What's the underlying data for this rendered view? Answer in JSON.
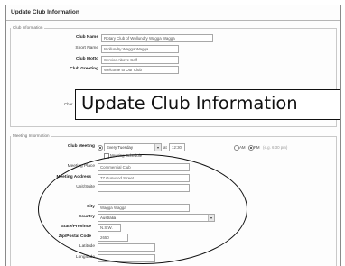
{
  "window": {
    "title": "Update Club Information"
  },
  "club_info": {
    "section_label": "Club information",
    "fields": [
      {
        "label": "Club Name",
        "value": "Rotary Club of Wollundry Wagga Wagga"
      },
      {
        "label": "Short Name",
        "value": "Wollundry Wagga Wagga"
      },
      {
        "label": "Club Motto",
        "value": "Service Above Self"
      },
      {
        "label": "Club Greeting",
        "value": "Welcome to Our Club"
      }
    ],
    "charter_label": "Char"
  },
  "meeting_info": {
    "section_label": "Meeting Information",
    "club_meeting": {
      "label": "Club Meeting",
      "frequency": "Every Tuesday",
      "at_label": "at",
      "time": "12:30",
      "am_label": "AM",
      "pm_label": "PM",
      "ampm_selected": "PM",
      "extra": "(e.g. 6:30 pm)",
      "schedule_label": "Meeting Schedule"
    },
    "fields": [
      {
        "label": "Meeting Place",
        "value": "Commercial Club"
      },
      {
        "label": "Meeting Address",
        "value": "77 Gurwood Street"
      },
      {
        "label": "Unit/Suite",
        "value": ""
      },
      {
        "label": "City",
        "value": "Wagga Wagga"
      },
      {
        "label": "Country",
        "value": "Australia"
      },
      {
        "label": "State/Province",
        "value": "N.S.W."
      },
      {
        "label": "Zip/Postal Code",
        "value": "2650"
      },
      {
        "label": "Latitude",
        "value": ""
      },
      {
        "label": "Longitude",
        "value": ""
      }
    ]
  },
  "overlay": {
    "caption": "Update Club Information"
  }
}
